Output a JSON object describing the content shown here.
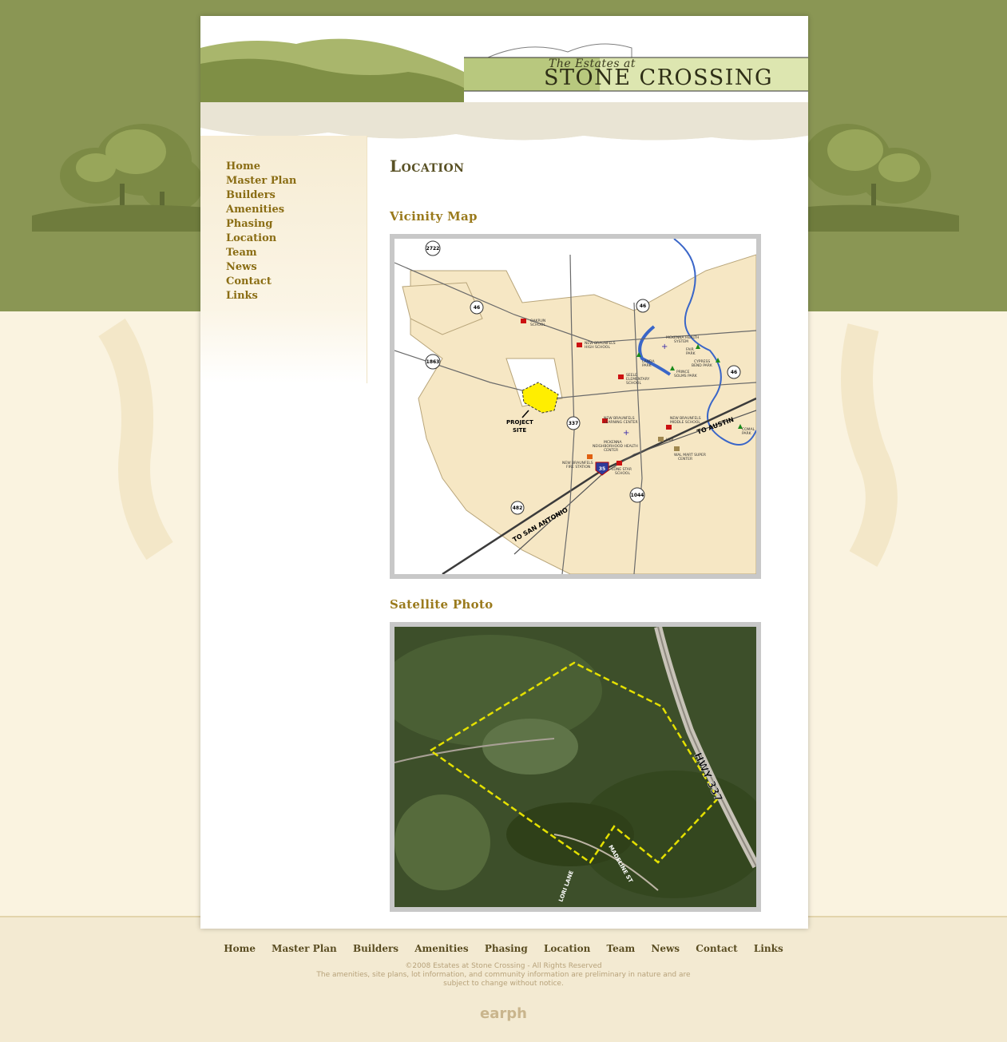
{
  "header": {
    "logo_line1": "The Estates at",
    "logo_line2": "STONE CROSSING"
  },
  "nav": {
    "items": [
      "Home",
      "Master Plan",
      "Builders",
      "Amenities",
      "Phasing",
      "Location",
      "Team",
      "News",
      "Contact",
      "Links"
    ]
  },
  "main": {
    "title": "Location",
    "vicinity_heading": "Vicinity Map",
    "satellite_heading": "Satellite Photo"
  },
  "vicinity_map": {
    "roads": [
      "2722",
      "46",
      "46",
      "46",
      "1863",
      "337",
      "482",
      "1044",
      "35"
    ],
    "directions": [
      "TO AUSTIN",
      "TO SAN ANTONIO"
    ],
    "labels": [
      "PROJECT SITE",
      "OAKRUN SCHOOL",
      "NEW BRAUNFELS HIGH SCHOOL",
      "SEELE ELEMENTARY SCHOOL",
      "NEW BRAUNFELS LEARNING CENTER",
      "NEW BRAUNFELS MIDDLE SCHOOL",
      "NEW BRAUNFELS FIRE STATION",
      "LONE STAR SCHOOL",
      "MCKENNA NEIGHBORHOOD HEALTH CENTER",
      "HEB",
      "WAL MART SUPER CENTER",
      "LANDA PARK",
      "FAIR PARK",
      "CYPRESS BEND PARK",
      "PRINCE SOLMS PARK",
      "COMAL PARK",
      "MCKENNA HEALTH SYSTEM"
    ]
  },
  "satellite": {
    "labels": [
      "HWY 337",
      "MADELINE ST",
      "LORI LANE"
    ]
  },
  "footer": {
    "nav": [
      "Home",
      "Master Plan",
      "Builders",
      "Amenities",
      "Phasing",
      "Location",
      "Team",
      "News",
      "Contact",
      "Links"
    ],
    "copyright": "©2008 Estates at Stone Crossing - All Rights Reserved",
    "disclaimer_1": "The amenities, site plans, lot information, and community information are preliminary in nature and are",
    "disclaimer_2": "subject to change without notice.",
    "credit": "earph"
  },
  "colors": {
    "background_green": "#8a9654",
    "nav_text": "#8a6d14",
    "heading": "#9a7a1c",
    "map_land": "#f6e7c4",
    "project_site": "#ffee00"
  }
}
